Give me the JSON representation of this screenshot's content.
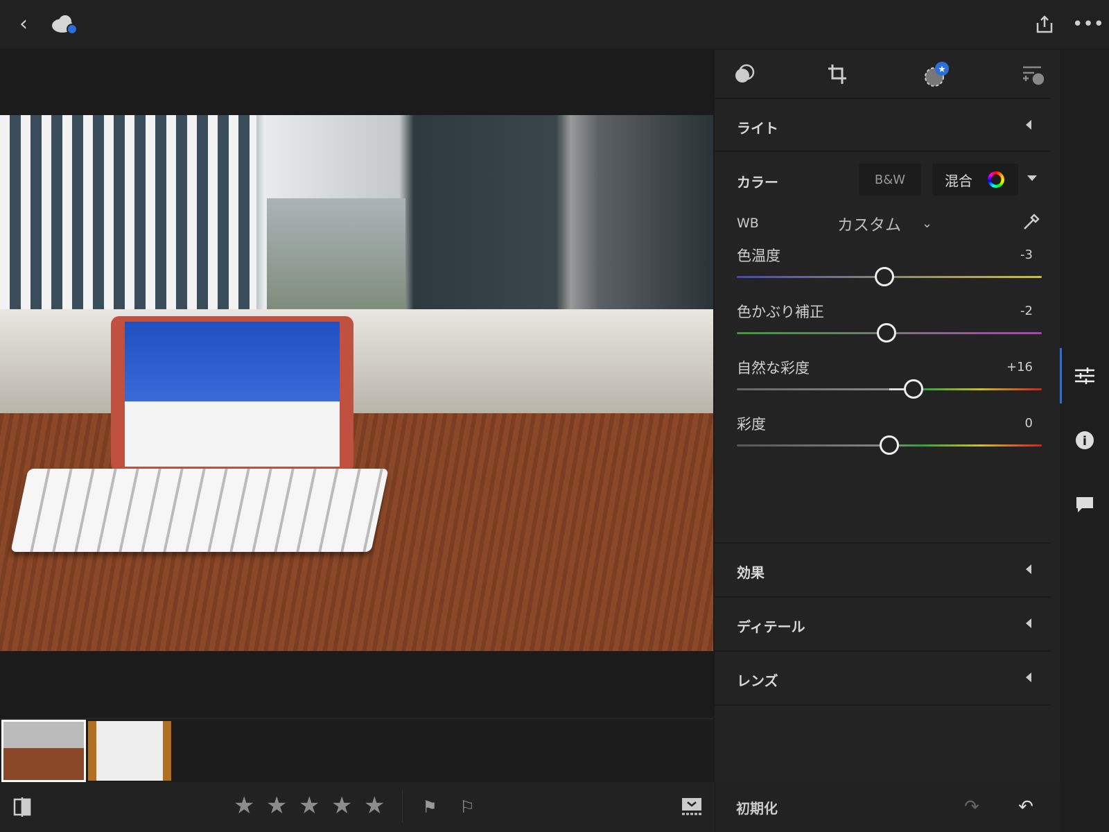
{
  "topbar": {
    "back": "chevron-left-icon",
    "cloud": "cloud-sync-icon",
    "share": "share-icon",
    "more": "more-icon"
  },
  "tools": [
    "selective-icon",
    "crop-icon",
    "presets-icon",
    "versions-icon"
  ],
  "sections": {
    "light": "ライト",
    "color": "カラー",
    "effects": "効果",
    "detail": "ディテール",
    "lens": "レンズ"
  },
  "color": {
    "bw": "B&W",
    "mix": "混合",
    "wb_label": "WB",
    "wb_value": "カスタム"
  },
  "sliders": [
    {
      "label": "色温度",
      "value": "-3",
      "num": -3,
      "gradient": "linear-gradient(90deg,#4848b8,#8a8a70,#c8c040)"
    },
    {
      "label": "色かぶり補正",
      "value": "-2",
      "num": -2,
      "gradient": "linear-gradient(90deg,#3c9a3c,#777,#b040b8)"
    },
    {
      "label": "自然な彩度",
      "value": "+16",
      "num": 16,
      "gradient": "linear-gradient(90deg,#666,#888 50%,#ddd 50%,#ddd 57%,#2aa040 60%,#c8c020 80%,#d02020)"
    },
    {
      "label": "彩度",
      "value": "0",
      "num": 0,
      "gradient": "linear-gradient(90deg,#555,#888 50%,#30a040 60%,#d0c020 80%,#d02020)"
    }
  ],
  "bottom": {
    "reset": "初期化",
    "rating": 0,
    "stars": 5
  },
  "accent": "#2a6fdb"
}
